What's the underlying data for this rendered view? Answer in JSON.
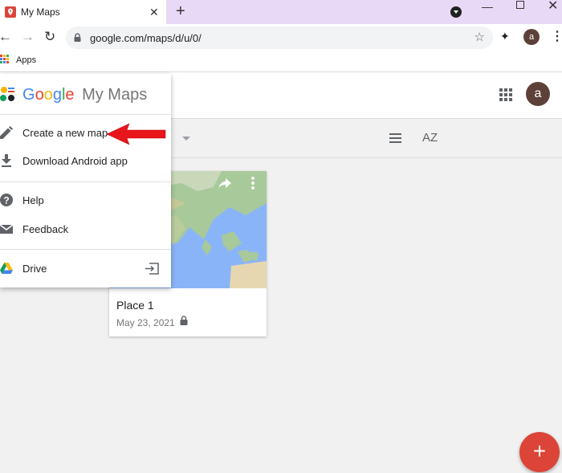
{
  "browser": {
    "tab": {
      "title": "My Maps",
      "close_glyph": "✕",
      "favicon": "map-pin-icon"
    },
    "new_tab_glyph": "+",
    "window_controls": {
      "minimize": "—",
      "close": "✕"
    },
    "nav": {
      "back": "←",
      "forward": "→",
      "reload": "↻"
    },
    "url": "google.com/maps/d/u/0/",
    "star_glyph": "☆",
    "extensions_glyph": "✦",
    "profile_initial": "a",
    "menu_glyph": "⋮"
  },
  "bookmarks": {
    "apps_label": "Apps"
  },
  "app": {
    "avatar_initial": "a",
    "logo": {
      "google": "Google",
      "product": "My Maps"
    },
    "menu": {
      "items": [
        {
          "label": "Create a new map",
          "icon": "pencil-icon"
        },
        {
          "label": "Download Android app",
          "icon": "download-icon"
        },
        {
          "label": "Help",
          "icon": "help-icon"
        },
        {
          "label": "Feedback",
          "icon": "feedback-icon"
        },
        {
          "label": "Drive",
          "icon": "drive-icon"
        }
      ]
    },
    "sort_label": "AZ",
    "cards": [
      {
        "title": "Place 1",
        "date": "May 23, 2021"
      }
    ],
    "fab_glyph": "+"
  },
  "colors": {
    "accent_red": "#db4437",
    "tab_strip": "#e8d9f6",
    "avatar": "#5d4037",
    "annotation_arrow": "#e8161b"
  }
}
